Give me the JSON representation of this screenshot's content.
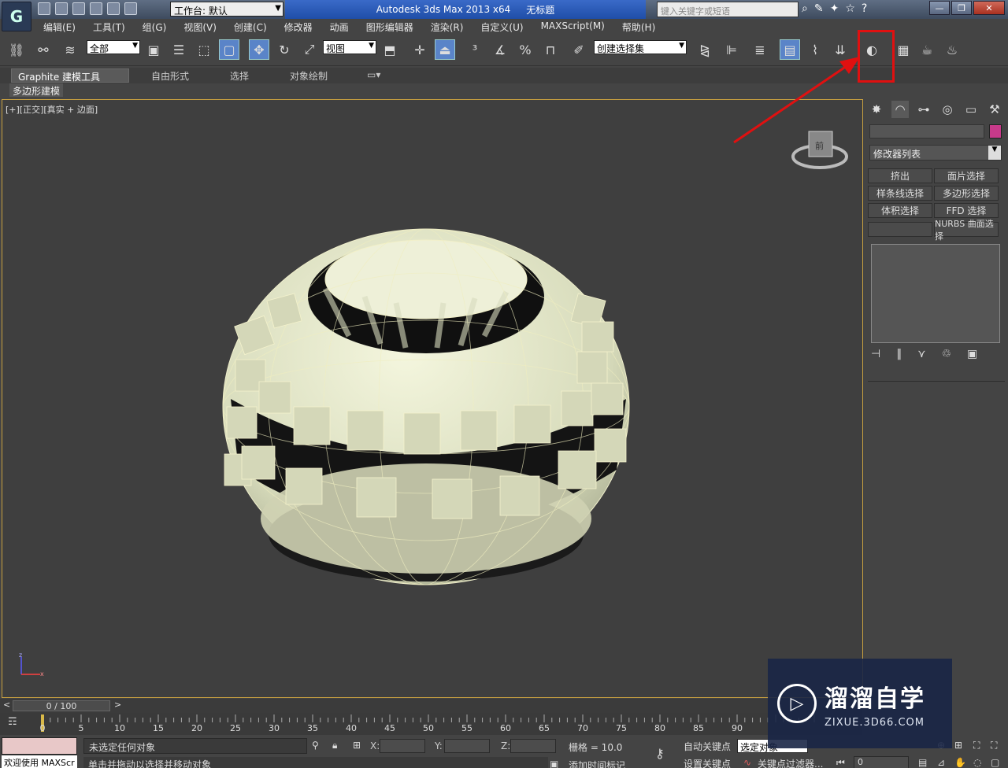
{
  "titlebar": {
    "app_logo": "G",
    "workspace_label": "工作台: 默认",
    "app_title": "Autodesk 3ds Max  2013 x64",
    "doc_title": "无标题",
    "search_placeholder": "键入关键字或短语"
  },
  "menu": [
    "编辑(E)",
    "工具(T)",
    "组(G)",
    "视图(V)",
    "创建(C)",
    "修改器",
    "动画",
    "图形编辑器",
    "渲染(R)",
    "自定义(U)",
    "MAXScript(M)",
    "帮助(H)"
  ],
  "toolbar": {
    "selection_filter": "全部",
    "ref_coord": "视图",
    "named_selection": "创建选择集"
  },
  "ribbon": {
    "tabs": [
      "Graphite 建模工具",
      "自由形式",
      "选择",
      "对象绘制"
    ],
    "active_panel": "多边形建模"
  },
  "viewport": {
    "label": "[+][正交][真实 + 边面]"
  },
  "command_panel": {
    "modifier_list": "修改器列表",
    "buttons": [
      "挤出",
      "面片选择",
      "样条线选择",
      "多边形选择",
      "体积选择",
      "FFD 选择",
      "",
      "NURBS 曲面选择"
    ]
  },
  "timeline": {
    "frame_display": "0 / 100",
    "ticks": [
      "0",
      "5",
      "10",
      "15",
      "20",
      "25",
      "30",
      "35",
      "40",
      "45",
      "50",
      "55",
      "60",
      "65",
      "70",
      "75",
      "80",
      "85",
      "90"
    ]
  },
  "statusbar": {
    "welcome": "欢迎使用 MAXScr",
    "status1": "未选定任何对象",
    "status2": "单击并拖动以选择并移动对象",
    "x_label": "X:",
    "y_label": "Y:",
    "z_label": "Z:",
    "grid": "栅格 = 10.0",
    "add_time_tag": "添加时间标记",
    "auto_key": "自动关键点",
    "set_key": "设置关键点",
    "selected_dropdown": "选定对象",
    "key_filters": "关键点过滤器...",
    "frame_field": "0"
  },
  "watermark": {
    "title": "溜溜自学",
    "url": "ZIXUE.3D66.COM"
  }
}
